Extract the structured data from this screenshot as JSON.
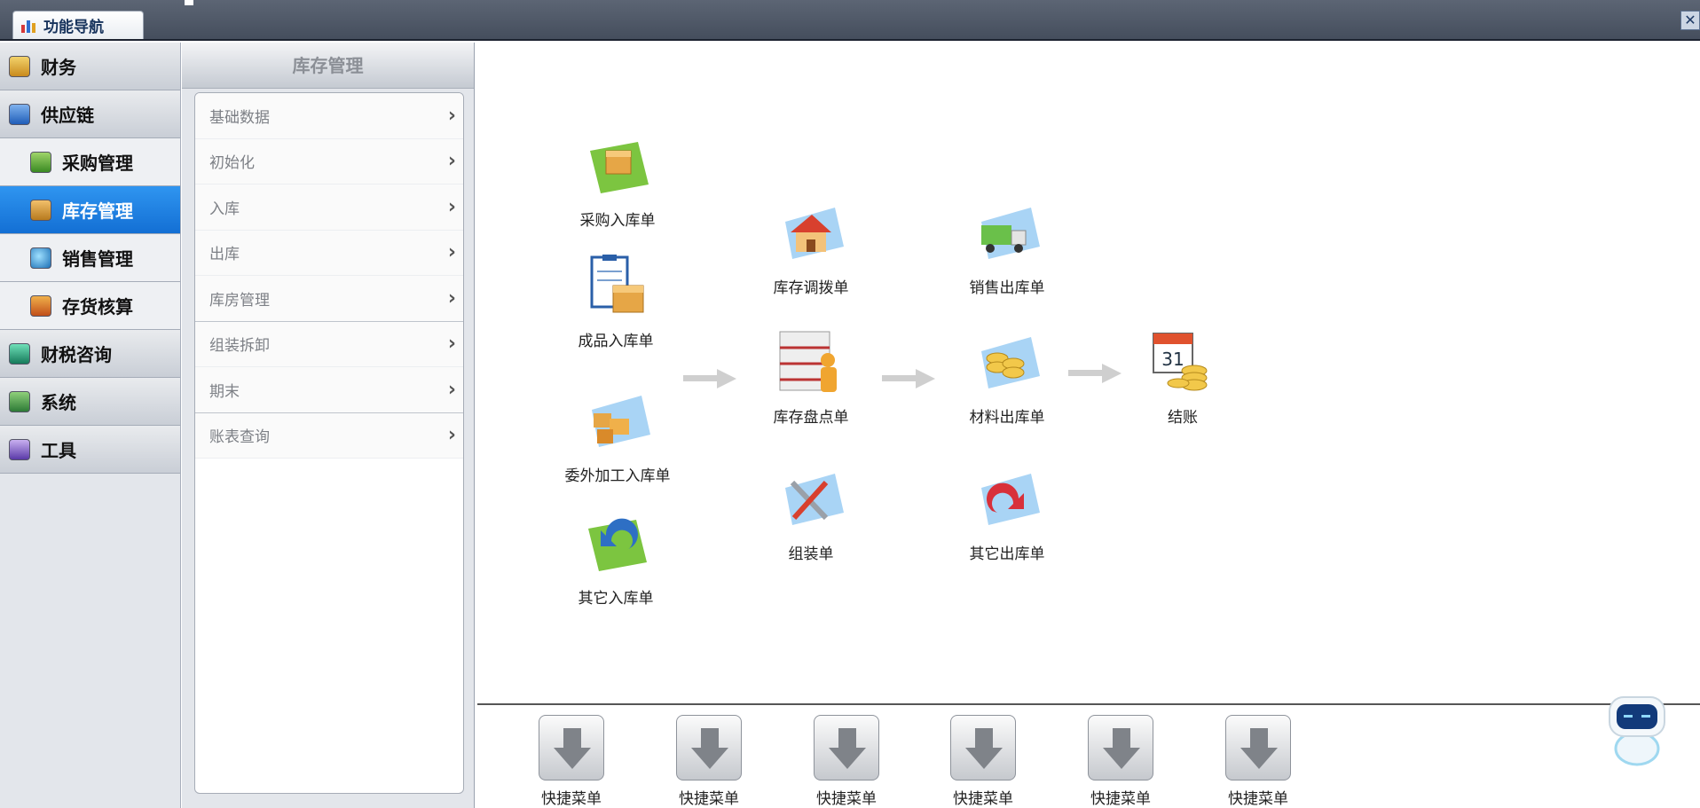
{
  "top_tab": {
    "label": "功能导航",
    "icon": "chart-bar-icon"
  },
  "close_button": {
    "glyph": "✕",
    "icon": "close-icon"
  },
  "sidebar": {
    "items": [
      {
        "label": "财务",
        "icon": "finance-icon",
        "level": "top",
        "active": false
      },
      {
        "label": "供应链",
        "icon": "supply-chain-link-icon",
        "level": "top",
        "active": false
      },
      {
        "label": "采购管理",
        "icon": "purchase-icon",
        "level": "sub",
        "active": false
      },
      {
        "label": "库存管理",
        "icon": "inventory-box-icon",
        "level": "sub",
        "active": true
      },
      {
        "label": "销售管理",
        "icon": "sales-globe-icon",
        "level": "sub",
        "active": false
      },
      {
        "label": "存货核算",
        "icon": "stock-accounting-icon",
        "level": "sub",
        "active": false
      },
      {
        "label": "财税咨询",
        "icon": "tax-consult-icon",
        "level": "top",
        "active": false
      },
      {
        "label": "系统",
        "icon": "system-monitor-icon",
        "level": "top",
        "active": false
      },
      {
        "label": "工具",
        "icon": "tools-icon",
        "level": "top",
        "active": false
      }
    ]
  },
  "submenu": {
    "title": "库存管理",
    "items": [
      {
        "label": "基础数据"
      },
      {
        "label": "初始化"
      },
      {
        "label": "入库"
      },
      {
        "label": "出库"
      },
      {
        "label": "库房管理"
      },
      {
        "label": "组装拆卸"
      },
      {
        "label": "期末"
      },
      {
        "label": "账表查询"
      }
    ]
  },
  "flow": {
    "nodes": [
      {
        "label": "采购入库单",
        "icon": "purchase-inbound-box-icon"
      },
      {
        "label": "成品入库单",
        "icon": "finished-goods-clipboard-icon"
      },
      {
        "label": "委外加工入库单",
        "icon": "outsourced-processing-icon"
      },
      {
        "label": "其它入库单",
        "icon": "other-inbound-return-icon"
      },
      {
        "label": "库存调拨单",
        "icon": "inventory-transfer-house-icon"
      },
      {
        "label": "库存盘点单",
        "icon": "inventory-count-shelf-icon"
      },
      {
        "label": "组装单",
        "icon": "assembly-tools-icon"
      },
      {
        "label": "销售出库单",
        "icon": "sales-outbound-truck-icon"
      },
      {
        "label": "材料出库单",
        "icon": "material-outbound-coins-icon"
      },
      {
        "label": "其它出库单",
        "icon": "other-outbound-arrow-icon"
      },
      {
        "label": "结账",
        "icon": "closing-calendar-coins-icon",
        "calendar_day": "31"
      }
    ]
  },
  "quick_menu": {
    "items": [
      {
        "label": "快捷菜单",
        "icon": "download-arrow-icon"
      },
      {
        "label": "快捷菜单",
        "icon": "download-arrow-icon"
      },
      {
        "label": "快捷菜单",
        "icon": "download-arrow-icon"
      },
      {
        "label": "快捷菜单",
        "icon": "download-arrow-icon"
      },
      {
        "label": "快捷菜单",
        "icon": "download-arrow-icon"
      },
      {
        "label": "快捷菜单",
        "icon": "download-arrow-icon"
      }
    ]
  },
  "assistant": {
    "icon": "robot-assistant-icon"
  },
  "colors": {
    "active_blue": "#1f80e0",
    "topbar": "#4f5868",
    "arrow_gray": "#cfcfcf"
  }
}
